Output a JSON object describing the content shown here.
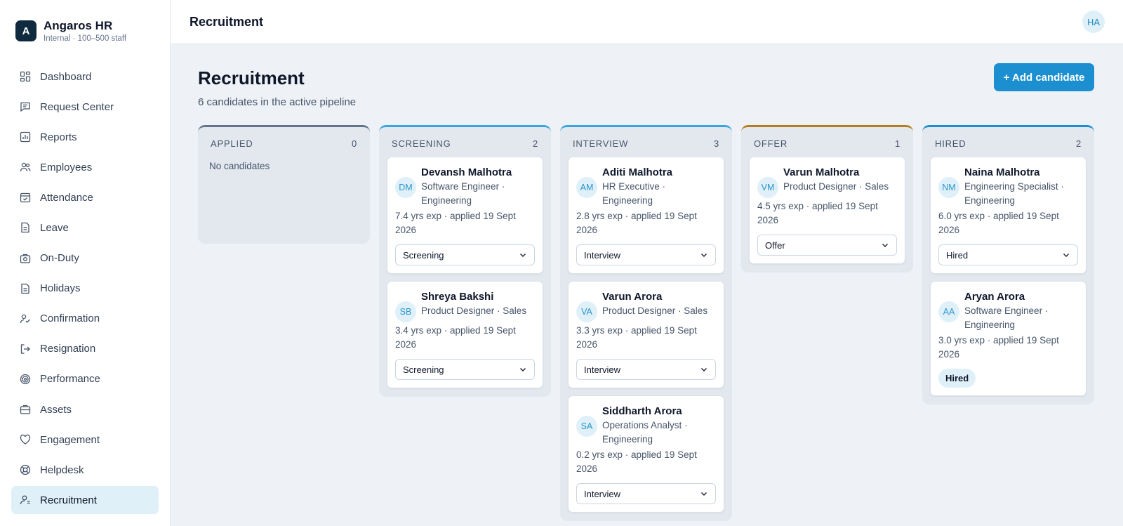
{
  "brand": {
    "logo_letter": "A",
    "name": "Angaros HR",
    "subtitle": "Internal · 100–500 staff"
  },
  "nav": [
    {
      "label": "Dashboard",
      "icon": "dashboard-icon"
    },
    {
      "label": "Request Center",
      "icon": "chat-icon"
    },
    {
      "label": "Reports",
      "icon": "chart-icon"
    },
    {
      "label": "Employees",
      "icon": "users-icon"
    },
    {
      "label": "Attendance",
      "icon": "calendar-check-icon"
    },
    {
      "label": "Leave",
      "icon": "document-icon"
    },
    {
      "label": "On-Duty",
      "icon": "briefcase-clock-icon"
    },
    {
      "label": "Holidays",
      "icon": "document-icon"
    },
    {
      "label": "Confirmation",
      "icon": "user-check-icon"
    },
    {
      "label": "Resignation",
      "icon": "logout-icon"
    },
    {
      "label": "Performance",
      "icon": "target-icon"
    },
    {
      "label": "Assets",
      "icon": "briefcase-icon"
    },
    {
      "label": "Engagement",
      "icon": "heart-icon"
    },
    {
      "label": "Helpdesk",
      "icon": "lifebuoy-icon"
    },
    {
      "label": "Recruitment",
      "icon": "user-icon",
      "active": true
    }
  ],
  "topbar": {
    "title": "Recruitment",
    "user_initials": "HA"
  },
  "page": {
    "title": "Recruitment",
    "subtitle": "6 candidates in the active pipeline",
    "add_button": "+ Add candidate"
  },
  "columns": [
    {
      "title": "APPLIED",
      "count": "0",
      "accent": "#64748b",
      "empty_text": "No candidates"
    },
    {
      "title": "SCREENING",
      "count": "2",
      "accent": "#38a5dd"
    },
    {
      "title": "INTERVIEW",
      "count": "3",
      "accent": "#38a5dd"
    },
    {
      "title": "OFFER",
      "count": "1",
      "accent": "#b57d1f"
    },
    {
      "title": "HIRED",
      "count": "2",
      "accent": "#1b8fd0"
    }
  ],
  "candidates": {
    "screening": [
      {
        "initials": "DM",
        "name": "Devansh Malhotra",
        "role": "Software Engineer · Engineering",
        "exp": "7.4 yrs exp · applied 19 Sept 2026",
        "stage": "Screening"
      },
      {
        "initials": "SB",
        "name": "Shreya Bakshi",
        "role": "Product Designer · Sales",
        "exp": "3.4 yrs exp · applied 19 Sept 2026",
        "stage": "Screening"
      }
    ],
    "interview": [
      {
        "initials": "AM",
        "name": "Aditi Malhotra",
        "role": "HR Executive · Engineering",
        "exp": "2.8 yrs exp · applied 19 Sept 2026",
        "stage": "Interview"
      },
      {
        "initials": "VA",
        "name": "Varun Arora",
        "role": "Product Designer · Sales",
        "exp": "3.3 yrs exp · applied 19 Sept 2026",
        "stage": "Interview"
      },
      {
        "initials": "SA",
        "name": "Siddharth Arora",
        "role": "Operations Analyst · Engineering",
        "exp": "0.2 yrs exp · applied 19 Sept 2026",
        "stage": "Interview"
      }
    ],
    "offer": [
      {
        "initials": "VM",
        "name": "Varun Malhotra",
        "role": "Product Designer · Sales",
        "exp": "4.5 yrs exp · applied 19 Sept 2026",
        "stage": "Offer"
      }
    ],
    "hired": [
      {
        "initials": "NM",
        "name": "Naina Malhotra",
        "role": "Engineering Specialist · Engineering",
        "exp": "6.0 yrs exp · applied 19 Sept 2026",
        "stage": "Hired"
      },
      {
        "initials": "AA",
        "name": "Aryan Arora",
        "role": "Software Engineer · Engineering",
        "exp": "3.0 yrs exp · applied 19 Sept 2026",
        "badge": "Hired"
      }
    ]
  }
}
